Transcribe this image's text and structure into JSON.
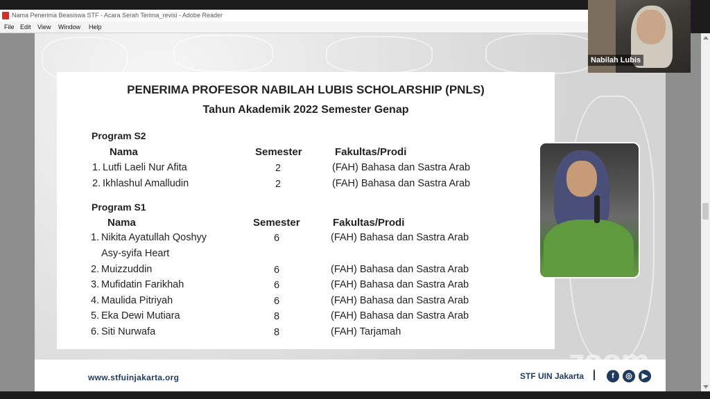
{
  "window": {
    "title": "Nama Penerima Beasiswa STF - Acara Serah Terima_revisi - Adobe Reader",
    "menu": [
      "File",
      "Edit",
      "View",
      "Window",
      "Help"
    ]
  },
  "slide": {
    "title": "PENERIMA PROFESOR NABILAH LUBIS SCHOLARSHIP (PNLS)",
    "subtitle": "Tahun Akademik 2022 Semester Genap",
    "programs": [
      {
        "heading": "Program S2",
        "columns": [
          "Nama",
          "Semester",
          "Fakultas/Prodi"
        ],
        "rows": [
          {
            "no": "1.",
            "name": "Lutfi Laeli Nur Afita",
            "semester": "2",
            "prodi": "(FAH) Bahasa dan Sastra Arab"
          },
          {
            "no": "2.",
            "name": "Ikhlashul Amalludin",
            "semester": "2",
            "prodi": "(FAH) Bahasa dan Sastra Arab"
          }
        ]
      },
      {
        "heading": "Program S1",
        "columns": [
          "Nama",
          "Semester",
          "Fakultas/Prodi"
        ],
        "rows": [
          {
            "no": "1.",
            "name": "Nikita Ayatullah Qoshyy",
            "name2": "Asy-syifa Heart",
            "semester": "6",
            "prodi": "(FAH) Bahasa dan Sastra Arab"
          },
          {
            "no": "2.",
            "name": "Muizzuddin",
            "semester": "6",
            "prodi": "(FAH) Bahasa dan Sastra Arab"
          },
          {
            "no": "3.",
            "name": "Mufidatin Farikhah",
            "semester": "6",
            "prodi": "(FAH) Bahasa dan Sastra Arab"
          },
          {
            "no": "4.",
            "name": "Maulida Pitriyah",
            "semester": "6",
            "prodi": "(FAH) Bahasa dan Sastra Arab"
          },
          {
            "no": "5.",
            "name": "Eka Dewi Mutiara",
            "semester": "8",
            "prodi": "(FAH) Bahasa dan Sastra Arab"
          },
          {
            "no": "6.",
            "name": "Siti Nurwafa",
            "semester": "8",
            "prodi": "(FAH) Tarjamah"
          }
        ]
      }
    ],
    "footer": {
      "url": "www.stfuinjakarta.org",
      "org": "STF UIN Jakarta",
      "social_icons": [
        "facebook-icon",
        "instagram-icon",
        "youtube-icon"
      ]
    }
  },
  "webcam": {
    "name": "Nabilah Lubis"
  },
  "watermark": "zoom"
}
